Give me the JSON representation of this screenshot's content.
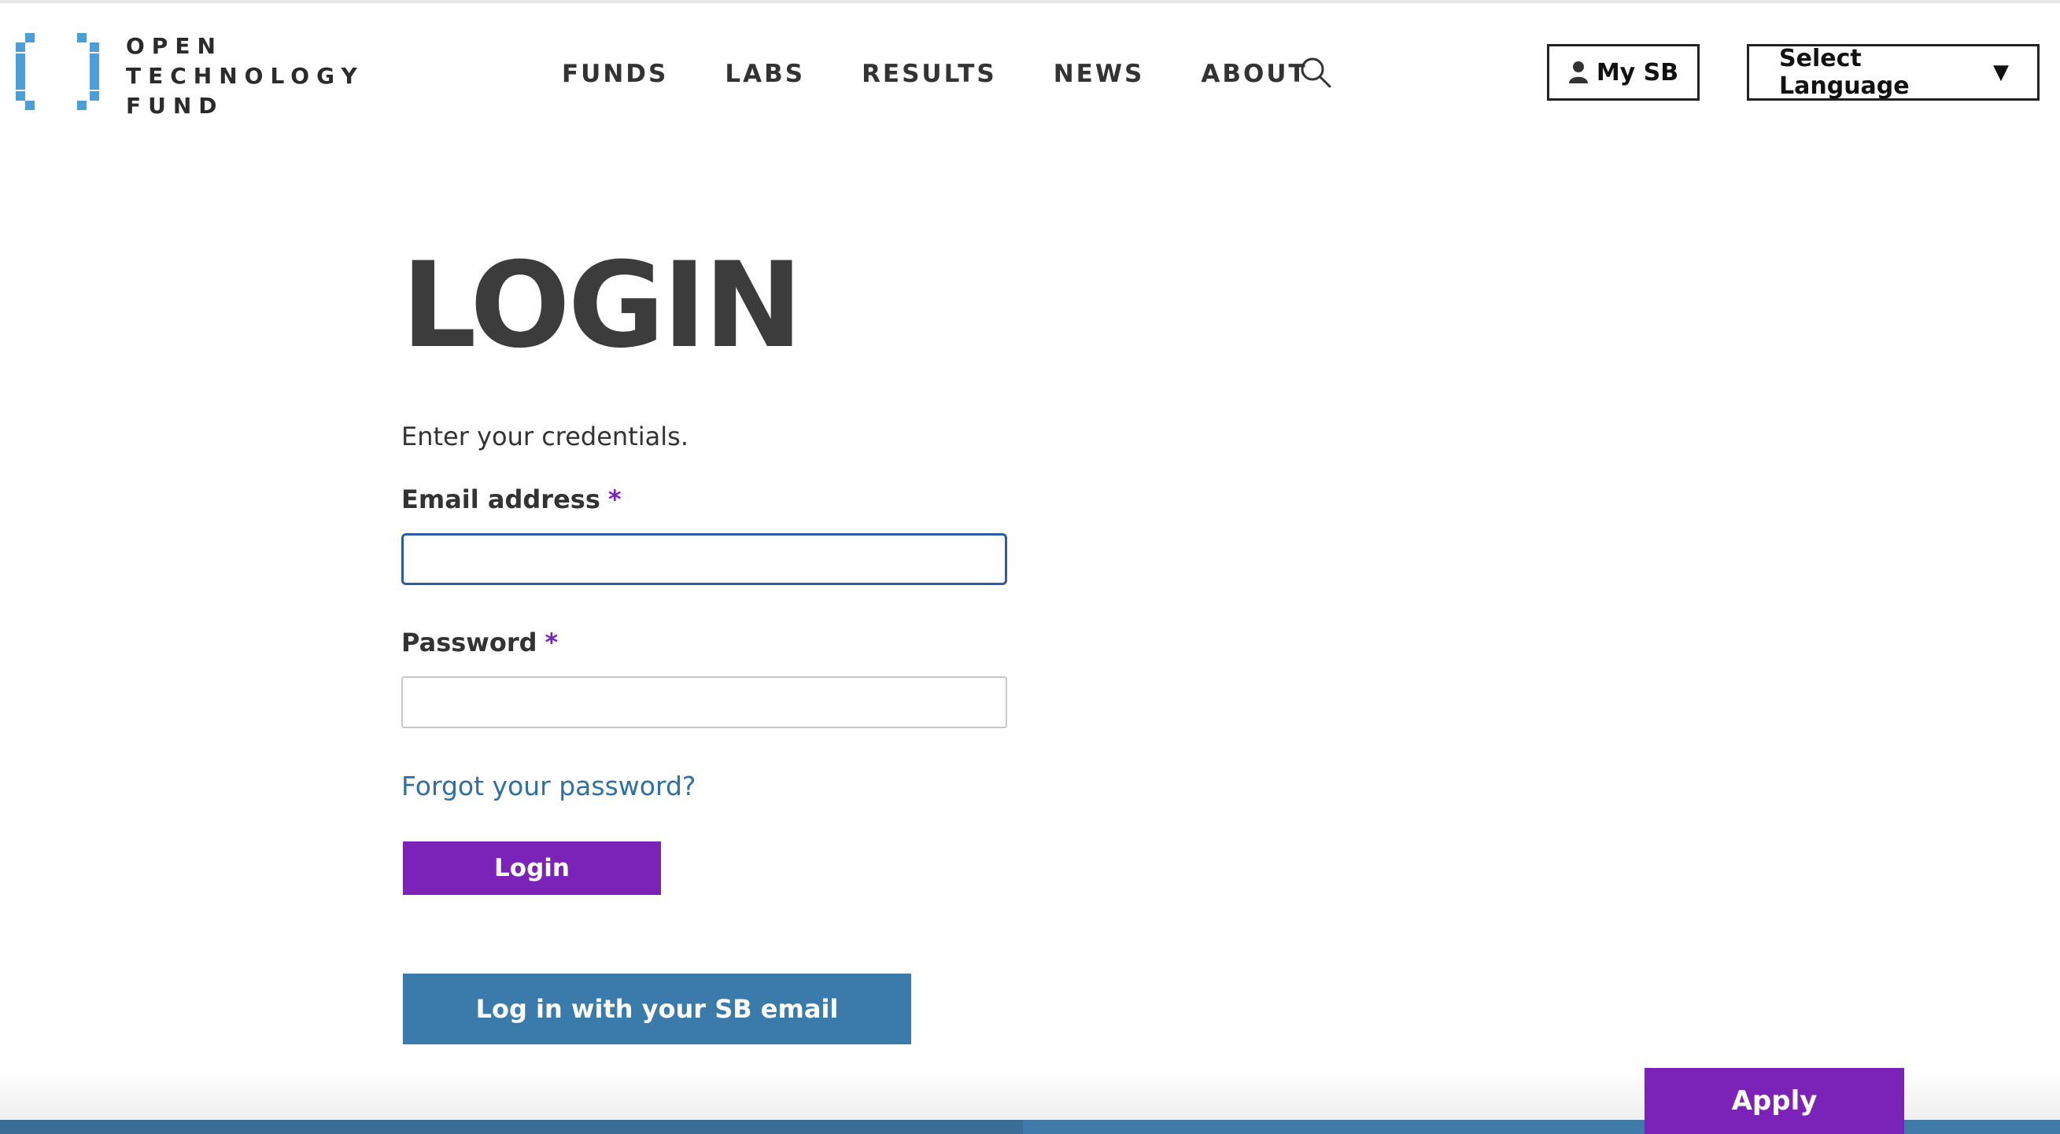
{
  "logo": {
    "lines": [
      "OPEN",
      "TECHNOLOGY",
      "FUND"
    ],
    "color": "#4a9fd8"
  },
  "nav": {
    "items": [
      "FUNDS",
      "LABS",
      "RESULTS",
      "NEWS",
      "ABOUT"
    ],
    "search_icon": "search-icon"
  },
  "header": {
    "my_sb_label": "My SB",
    "language_label": "Select Language",
    "language_caret": "▼"
  },
  "login": {
    "title": "LOGIN",
    "intro": "Enter your credentials.",
    "email_label": "Email address",
    "email_value": "",
    "password_label": "Password",
    "password_value": "",
    "required_marker": "*",
    "forgot_link": "Forgot your password?",
    "login_button": "Login",
    "sso_button": "Log in with your SB email"
  },
  "footer": {
    "apply_button": "Apply"
  },
  "colors": {
    "accent_purple": "#7b22b8",
    "accent_blue": "#3b7bab",
    "link_blue": "#2f6fa8",
    "focus_border": "#2a5caa"
  }
}
